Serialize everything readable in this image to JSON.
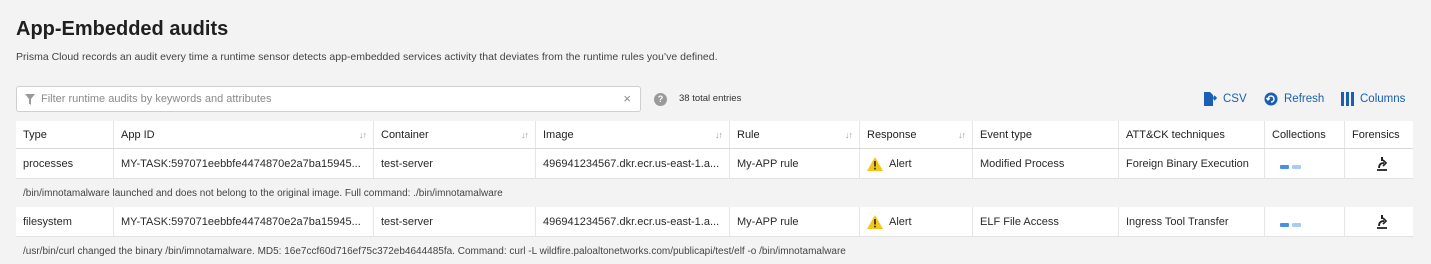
{
  "page": {
    "title": "App-Embedded audits",
    "description": "Prisma Cloud records an audit every time a runtime sensor detects app-embedded services activity that deviates from the runtime rules you’ve defined."
  },
  "filter": {
    "placeholder": "Filter runtime audits by keywords and attributes",
    "value": "",
    "clear_glyph": "×"
  },
  "help_glyph": "?",
  "total_entries": "38 total entries",
  "toolbar": {
    "csv_label": "CSV",
    "refresh_label": "Refresh",
    "columns_label": "Columns"
  },
  "colors": {
    "accent": "#1a5fb4",
    "alert": "#f5c518",
    "collection_dark": "#4a90e2",
    "collection_light": "#a9cdf2"
  },
  "table": {
    "columns": [
      "Type",
      "App ID",
      "Container",
      "Image",
      "Rule",
      "Response",
      "Event type",
      "ATT&CK techniques",
      "Collections",
      "Forensics"
    ],
    "sort_glyph": "↓↑",
    "rows": [
      {
        "type": "processes",
        "app_id": "MY-TASK:597071eebbfe4474870e2a7ba15945...",
        "container": "test-server",
        "image": "496941234567.dkr.ecr.us-east-1.a...",
        "rule": "My-APP rule",
        "response": "Alert",
        "event_type": "Modified Process",
        "attck": "Foreign Binary Execution",
        "collections_icon": "collections-icon",
        "forensics_icon": "forensics-icon",
        "detail": "/bin/imnotamalware launched and does not belong to the original image. Full command: ./bin/imnotamalware"
      },
      {
        "type": "filesystem",
        "app_id": "MY-TASK:597071eebbfe4474870e2a7ba15945...",
        "container": "test-server",
        "image": "496941234567.dkr.ecr.us-east-1.a...",
        "rule": "My-APP rule",
        "response": "Alert",
        "event_type": "ELF File Access",
        "attck": "Ingress Tool Transfer",
        "collections_icon": "collections-icon",
        "forensics_icon": "forensics-icon",
        "detail": "/usr/bin/curl changed the binary /bin/imnotamalware. MD5: 16e7ccf60d716ef75c372eb4644485fa. Command: curl -L wildfire.paloaltonetworks.com/publicapi/test/elf -o /bin/imnotamalware"
      }
    ]
  }
}
